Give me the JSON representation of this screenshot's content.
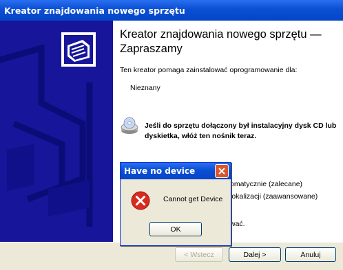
{
  "window": {
    "title": "Kreator znajdowania nowego sprzętu"
  },
  "content": {
    "heading": "Kreator znajdowania nowego sprzętu — Zapraszamy",
    "intro": "Ten kreator pomaga zainstalować oprogramowanie dla:",
    "device_name": "Nieznany",
    "cd_instruction": "Jeśli do sprzętu dołączony był instalacyjny dysk CD lub dyskietka, włóż ten nośnik teraz.",
    "option_auto_partial": "omatycznie (zalecane)",
    "option_manual_partial": "lokalizacji (zaawansowane)",
    "continue_partial": "wać."
  },
  "footer": {
    "back_label": "< Wstecz",
    "next_label": "Dalej >",
    "cancel_label": "Anuluj"
  },
  "dialog": {
    "title": "Have no device",
    "message": "Cannot get Device",
    "ok_label": "OK"
  },
  "colors": {
    "title_bar": "#0a4fd4",
    "left_panel": "#17169a",
    "footer": "#ece9d8",
    "close_button": "#d8562f",
    "error_icon": "#d92b1f"
  }
}
